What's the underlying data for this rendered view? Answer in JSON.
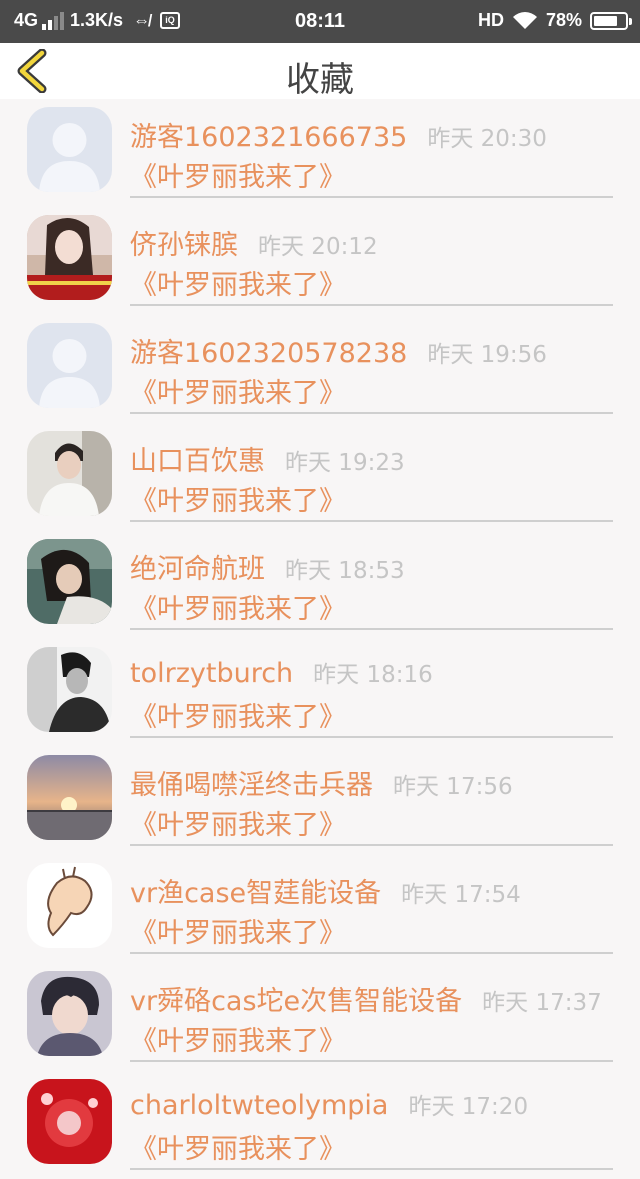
{
  "status_bar": {
    "network": "4G",
    "speed": "1.3K/s",
    "time": "08:11",
    "hd": "HD",
    "battery": "78%",
    "battery_level": 0.78
  },
  "nav": {
    "title": "收藏",
    "back_icon": "chevron-left-icon"
  },
  "items": [
    {
      "name": "游客1602321666735",
      "time": "昨天 20:30",
      "title": "《叶罗丽我来了》",
      "avatar": "default-user"
    },
    {
      "name": "侪孙铼膑",
      "time": "昨天 20:12",
      "title": "《叶罗丽我来了》",
      "avatar": "photo-girl"
    },
    {
      "name": "游客1602320578238",
      "time": "昨天 19:56",
      "title": "《叶罗丽我来了》",
      "avatar": "default-user"
    },
    {
      "name": "山口百饮惠",
      "time": "昨天 19:23",
      "title": "《叶罗丽我来了》",
      "avatar": "photo-boy"
    },
    {
      "name": "绝河命航班",
      "time": "昨天 18:53",
      "title": "《叶罗丽我来了》",
      "avatar": "photo-woman"
    },
    {
      "name": "tolrzytburch",
      "time": "昨天 18:16",
      "title": "《叶罗丽我来了》",
      "avatar": "photo-bw"
    },
    {
      "name": "最俑喝噤淫终击兵器",
      "time": "昨天 17:56",
      "title": "《叶罗丽我来了》",
      "avatar": "photo-sunset"
    },
    {
      "name": "vr渔case智莛能设备",
      "time": "昨天 17:54",
      "title": "《叶罗丽我来了》",
      "avatar": "cartoon-sketch"
    },
    {
      "name": "vr舜硌cas坨e次售智能设备",
      "time": "昨天 17:37",
      "title": "《叶罗丽我来了》",
      "avatar": "anime-boy"
    },
    {
      "name": "charloltwteolympia",
      "time": "昨天 17:20",
      "title": "《叶罗丽我来了》",
      "avatar": "photo-red"
    }
  ]
}
